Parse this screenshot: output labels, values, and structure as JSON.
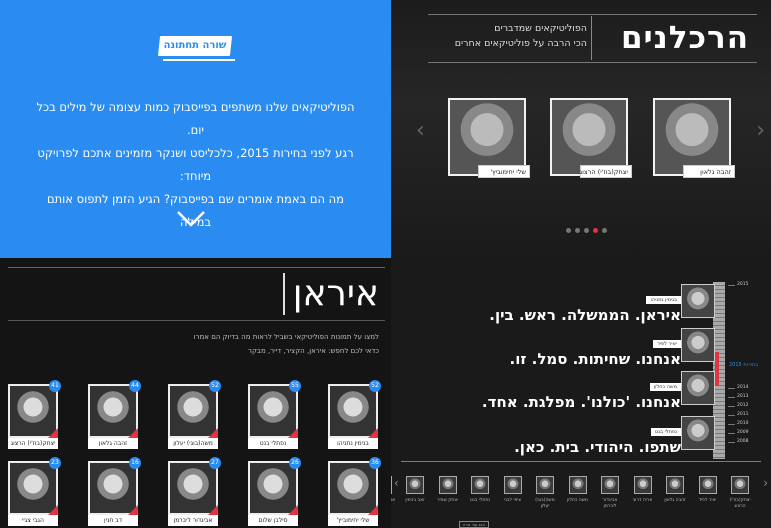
{
  "intro": {
    "logo_text": "שורה תחתונה",
    "lines": [
      "הפוליטיקאים שלנו משתפים בפייסבוק כמות עצומה של מילים בכל יום.",
      "רגע לפני בחירות 2015, כלכליסט ושנקר מזמינים אתכם לפרויקט מיוחד:",
      "מה הם באמת אומרים שם בפייסבוק? הגיע הזמן לתפוס אותם במילה"
    ],
    "colors": {
      "background": "#2a8cf0"
    }
  },
  "carousel": {
    "title": "הרכלנים",
    "subtitle_lines": [
      "הפוליטיקאים שמדברים",
      "הכי הרבה על פוליטיקאים אחרים"
    ],
    "cards": [
      {
        "name": "זהבה גלאון"
      },
      {
        "name": "יצחק(בוז'י) הרצוג"
      },
      {
        "name": "שלי יחימוביץ'"
      }
    ],
    "dots_count": 5,
    "active_dot": 1,
    "prev_icon": "chevron-left-icon",
    "next_icon": "chevron-right-icon"
  },
  "iran": {
    "title": "איראן",
    "desc_lines": [
      "למצו על תמונות הפוליטיקאי בשביל לראות מה בדיוק הם אמרו",
      "כדאי לכם לחפש: איראן, הקציר, דייר, מבקר"
    ],
    "row1": [
      {
        "name": "יצחק(בוז'י) הרצוג",
        "count": "41"
      },
      {
        "name": "זהבה גלאון",
        "count": "44"
      },
      {
        "name": "משה(בוגי) יעלון",
        "count": "52"
      },
      {
        "name": "נפתלי בנט",
        "count": "55"
      },
      {
        "name": "בנימין נתניהו",
        "count": "52"
      }
    ],
    "row2": [
      {
        "name": "הגבי צגיי",
        "count": "23"
      },
      {
        "name": "דב חנין",
        "count": "16"
      },
      {
        "name": "אביגדור ליברמן",
        "count": "27"
      },
      {
        "name": "סילבן שלום",
        "count": "26"
      },
      {
        "name": "שלי יחימוביץ'",
        "count": "36"
      }
    ]
  },
  "quotes": {
    "items": [
      {
        "tag": "בנימין נתניהו",
        "text": "איראן. הממשלה. ראש. בין."
      },
      {
        "tag": "יאיר לפיד",
        "text": "אנחנו. שחיתות. סמל. זו."
      },
      {
        "tag": "משה כחלון",
        "text": "אנחנו. 'כולנו'. מפלגת. אחד."
      },
      {
        "tag": "נפתלי בנט",
        "text": "שתפו. היהודי. בית. כאן."
      }
    ],
    "timeline_years": [
      "2015",
      "2014",
      "2013",
      "2012",
      "2011",
      "2010",
      "2009",
      "2008"
    ],
    "timeline_marker": "בחירות 2015",
    "strip": [
      "יצחק(בוז'י) הרצוג",
      "יאיר לפיד",
      "זהבה גלאון",
      "אריה דרעי",
      "אביגדור ליברמן",
      "משה כחלון",
      "משה(בוגי) יעלון",
      "ציפי לבני",
      "נפתלי בנט",
      "יצחק שמיר",
      "זאב בנימין",
      "אופיר אקוניס"
    ],
    "more_label": "הצג עוד ארה"
  }
}
